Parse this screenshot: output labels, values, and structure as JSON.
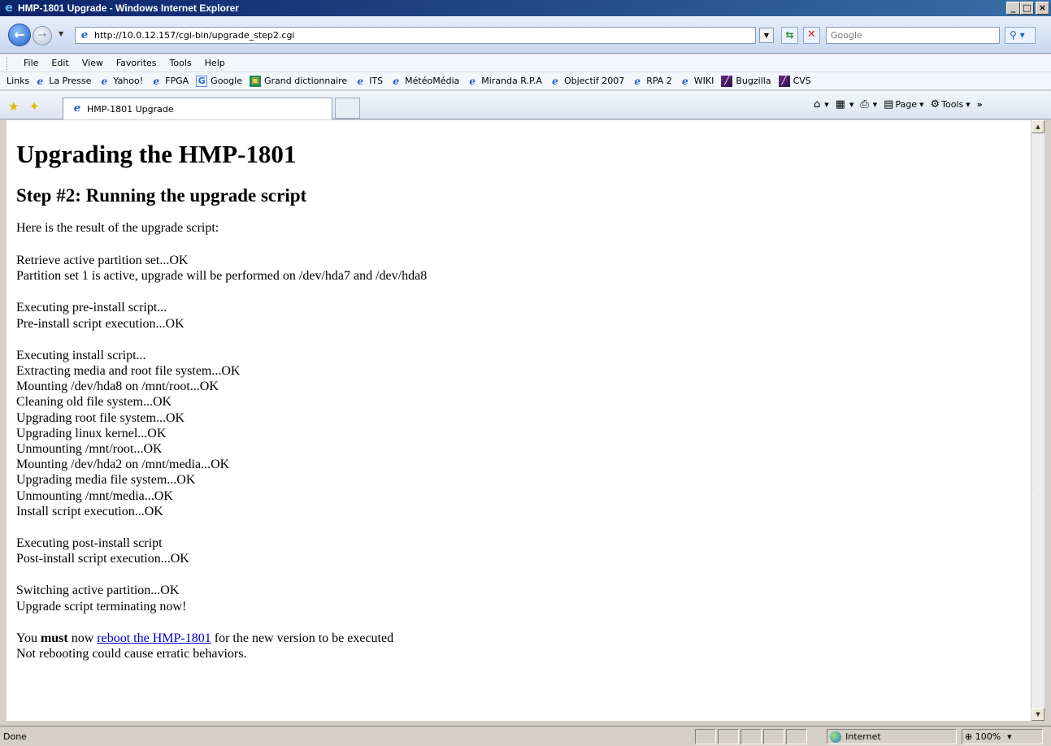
{
  "window": {
    "title": "HMP-1801 Upgrade - Windows Internet Explorer",
    "min_label": "_",
    "max_label": "□",
    "close_label": "×"
  },
  "address": {
    "url": "http://10.0.12.157/cgi-bin/upgrade_step2.cgi",
    "search_placeholder": "Google"
  },
  "menu": [
    "File",
    "Edit",
    "View",
    "Favorites",
    "Tools",
    "Help"
  ],
  "links": {
    "label": "Links",
    "items": [
      {
        "label": "La Presse",
        "icon": "ie-page-icon"
      },
      {
        "label": "Yahoo!",
        "icon": "ie-page-icon"
      },
      {
        "label": "FPGA",
        "icon": "ie-page-icon"
      },
      {
        "label": "Google",
        "icon": "google-icon"
      },
      {
        "label": "Grand dictionnaire",
        "icon": "gdt-icon"
      },
      {
        "label": "ITS",
        "icon": "ie-page-icon"
      },
      {
        "label": "MétéoMédia",
        "icon": "ie-page-icon"
      },
      {
        "label": "Miranda R.P.A",
        "icon": "ie-page-icon"
      },
      {
        "label": "Objectif 2007",
        "icon": "ie-page-icon"
      },
      {
        "label": "RPA 2",
        "icon": "ie-page-icon"
      },
      {
        "label": "WIKI",
        "icon": "ie-page-icon"
      },
      {
        "label": "Bugzilla",
        "icon": "bugzilla-icon"
      },
      {
        "label": "CVS",
        "icon": "bugzilla-icon"
      }
    ]
  },
  "tab": {
    "label": "HMP-1801 Upgrade"
  },
  "commandbar": {
    "page_label": "Page",
    "tools_label": "Tools",
    "more_label": "»"
  },
  "doc": {
    "title": "Upgrading the HMP-1801",
    "subtitle": "Step #2: Running the upgrade script",
    "intro": "Here is the result of the upgrade script:",
    "blocks": [
      [
        "Retrieve active partition set...OK",
        "Partition set 1 is active, upgrade will be performed on /dev/hda7 and /dev/hda8"
      ],
      [
        "Executing pre-install script...",
        "Pre-install script execution...OK"
      ],
      [
        "Executing install script...",
        "Extracting media and root file system...OK",
        "Mounting /dev/hda8 on /mnt/root...OK",
        "Cleaning old file system...OK",
        "Upgrading root file system...OK",
        "Upgrading linux kernel...OK",
        "Unmounting /mnt/root...OK",
        "Mounting /dev/hda2 on /mnt/media...OK",
        "Upgrading media file system...OK",
        "Unmounting /mnt/media...OK",
        "Install script execution...OK"
      ],
      [
        "Executing post-install script",
        "Post-install script execution...OK"
      ],
      [
        "Switching active partition...OK",
        "Upgrade script terminating now!"
      ]
    ],
    "final": {
      "you": "You",
      "must": "must",
      "now": "now",
      "link": "reboot the HMP-1801",
      "rest": "for the new version to be executed",
      "warning": "Not rebooting could cause erratic behaviors."
    }
  },
  "status": {
    "text": "Done",
    "zone": "Internet",
    "zoom": "100%"
  },
  "colors": {
    "titlebar_start": "#0a246a",
    "titlebar_end": "#3a6ea5",
    "link": "#0000cc"
  }
}
